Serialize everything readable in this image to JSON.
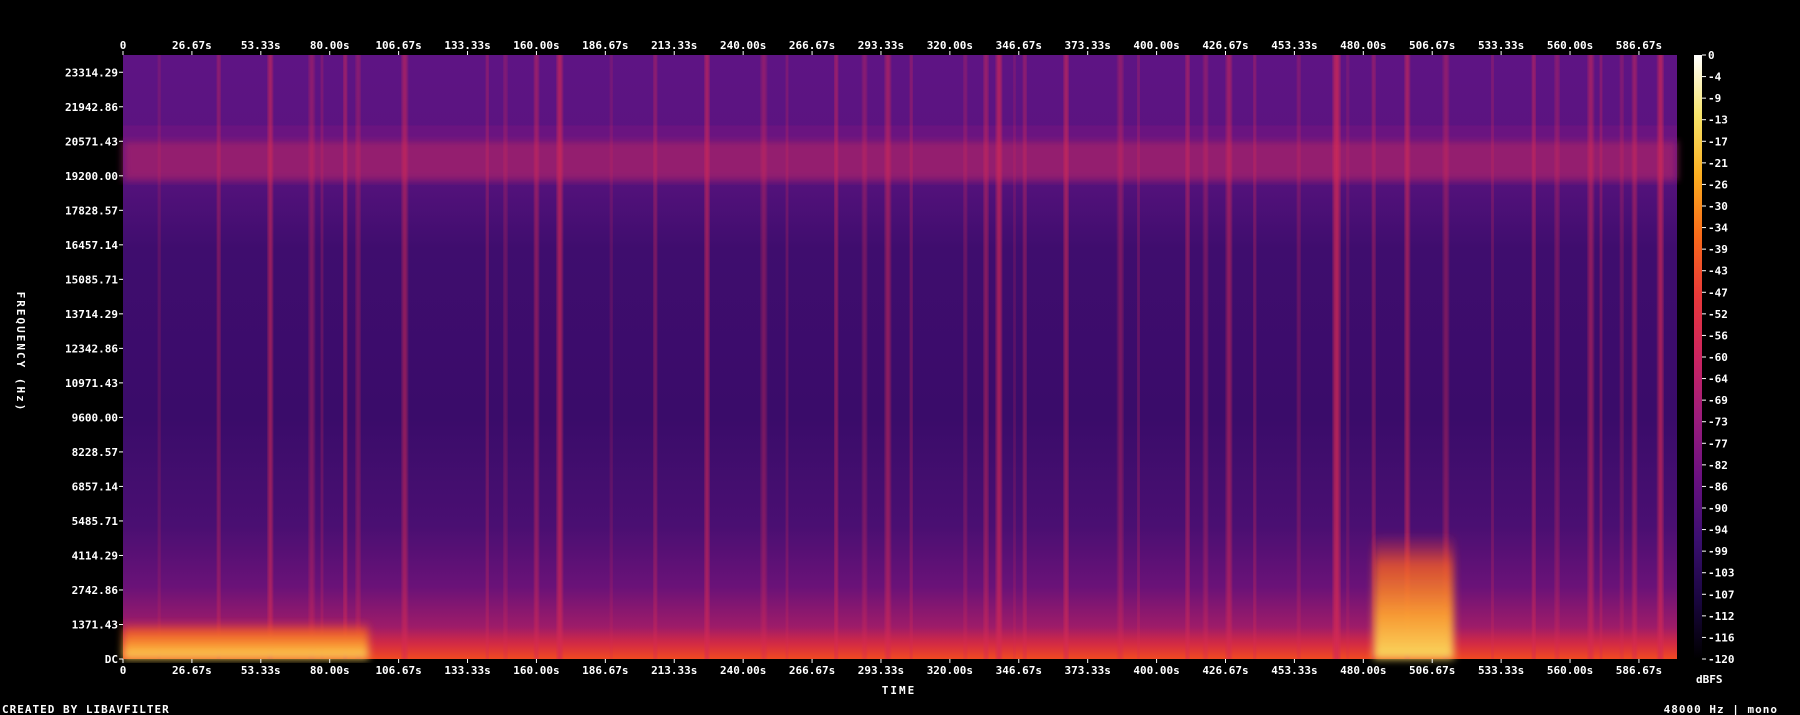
{
  "chart_data": {
    "type": "heatmap",
    "xlabel": "TIME",
    "ylabel": "FREQUENCY (Hz)",
    "colorbar_label": "dBFS",
    "footer_left": "CREATED BY LIBAVFILTER",
    "footer_right": "48000 Hz | mono",
    "x_range_s": [
      0,
      601.4
    ],
    "y_range_hz": [
      0,
      24000
    ],
    "colorbar_range_dbfs": [
      -120,
      0
    ],
    "x_ticks": [
      "0",
      "26.67s",
      "53.33s",
      "80.00s",
      "106.67s",
      "133.33s",
      "160.00s",
      "186.67s",
      "213.33s",
      "240.00s",
      "266.67s",
      "293.33s",
      "320.00s",
      "346.67s",
      "373.33s",
      "400.00s",
      "426.67s",
      "453.33s",
      "480.00s",
      "506.67s",
      "533.33s",
      "560.00s",
      "586.67s"
    ],
    "y_ticks": [
      "DC",
      "1371.43",
      "2742.86",
      "4114.29",
      "5485.71",
      "6857.14",
      "8228.57",
      "9600.00",
      "10971.43",
      "12342.86",
      "13714.29",
      "15085.71",
      "16457.14",
      "17828.57",
      "19200.00",
      "20571.43",
      "21942.86",
      "23314.29"
    ],
    "colorbar_ticks": [
      "0",
      "-4",
      "-9",
      "-13",
      "-17",
      "-21",
      "-26",
      "-30",
      "-34",
      "-39",
      "-43",
      "-47",
      "-52",
      "-56",
      "-60",
      "-64",
      "-69",
      "-73",
      "-77",
      "-82",
      "-86",
      "-90",
      "-94",
      "-99",
      "-103",
      "-107",
      "-112",
      "-116",
      "-120"
    ],
    "colormap": [
      "#000000",
      "#1a0640",
      "#3b0f70",
      "#6a1080",
      "#9c1c7c",
      "#cc2460",
      "#e8383a",
      "#f96a1a",
      "#fcae20",
      "#f7e46a",
      "#ffffff"
    ],
    "band_hz": [
      19000,
      20600
    ],
    "loud_regions": [
      {
        "t_start": 484,
        "t_end": 515,
        "f_max_hz": 5000
      },
      {
        "t_start": 0,
        "t_end": 95,
        "f_max_hz": 1500
      }
    ],
    "transient_times_s": [
      14,
      37,
      57,
      73,
      77,
      86,
      91,
      109,
      141,
      148,
      160,
      169,
      189,
      206,
      226,
      248,
      257,
      276,
      287,
      296,
      305,
      326,
      334,
      339,
      345,
      349,
      365,
      386,
      393,
      412,
      419,
      428,
      438,
      455,
      469,
      470,
      474,
      484,
      497,
      512,
      530,
      546,
      555,
      568,
      572,
      580,
      585,
      595
    ]
  }
}
